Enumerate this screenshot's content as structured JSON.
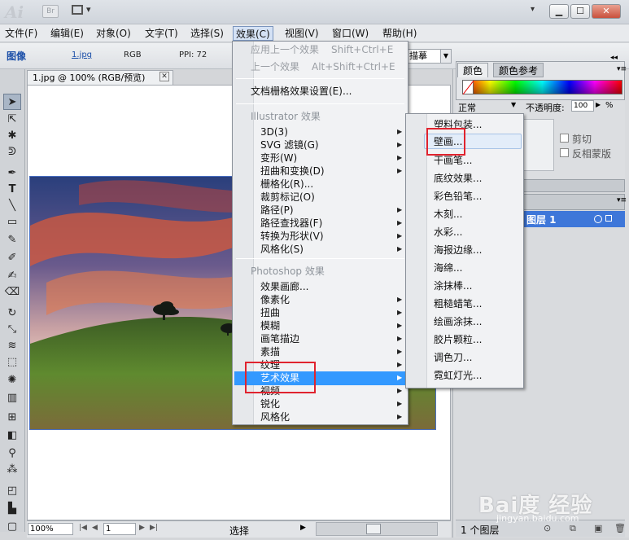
{
  "app": {
    "logo": "Ai",
    "bridge": "Br",
    "window_buttons": [
      "▁",
      "☐",
      "✕"
    ]
  },
  "menubar": [
    "文件(F)",
    "编辑(E)",
    "对象(O)",
    "文字(T)",
    "选择(S)",
    "效果(C)",
    "视图(V)",
    "窗口(W)",
    "帮助(H)"
  ],
  "control_bar": {
    "label": "图像",
    "file": "1.jpg",
    "mode": "RGB",
    "ppi": "PPI: 72",
    "trace_fragment": "描摹"
  },
  "document": {
    "tab_title": "1.jpg @ 100% (RGB/预览)",
    "zoom": "100%",
    "page": "1",
    "status": "选择"
  },
  "effect_menu": {
    "apply_last": "应用上一个效果",
    "apply_last_shortcut": "Shift+Ctrl+E",
    "last_effect": "上一个效果",
    "last_effect_shortcut": "Alt+Shift+Ctrl+E",
    "doc_raster": "文档栅格效果设置(E)...",
    "illustrator_header": "Illustrator 效果",
    "illustrator_items": [
      "3D(3)",
      "SVG 滤镜(G)",
      "变形(W)",
      "扭曲和变换(D)",
      "栅格化(R)...",
      "裁剪标记(O)",
      "路径(P)",
      "路径查找器(F)",
      "转换为形状(V)",
      "风格化(S)"
    ],
    "photoshop_header": "Photoshop 效果",
    "photoshop_items": [
      "效果画廊...",
      "像素化",
      "扭曲",
      "模糊",
      "画笔描边",
      "素描",
      "纹理",
      "艺术效果",
      "视频",
      "锐化",
      "风格化"
    ]
  },
  "artistic_submenu": [
    "塑料包装...",
    "壁画...",
    "干画笔...",
    "底纹效果...",
    "彩色铅笔...",
    "木刻...",
    "水彩...",
    "海报边缘...",
    "海绵...",
    "涂抹棒...",
    "粗糙蜡笔...",
    "绘画涂抹...",
    "胶片颗粒...",
    "调色刀...",
    "霓虹灯光..."
  ],
  "color_panel": {
    "tab_color": "颜色",
    "tab_guide": "颜色参考"
  },
  "transparency_panel": {
    "blend_mode": "正常",
    "opacity_label": "不透明度:",
    "opacity_value": "100",
    "opacity_unit": "%",
    "clip": "剪切",
    "invert_mask": "反相蒙版"
  },
  "layers_panel": {
    "layer_name": "图层 1",
    "layer_count": "1 个图层"
  },
  "watermark": {
    "brand": "Bai度 经验",
    "url": "jingyan.baidu.com"
  },
  "colors": {
    "menu_highlight": "#3399ff",
    "annotation_red": "#e0232e",
    "layer_selected": "#3e77d9"
  }
}
